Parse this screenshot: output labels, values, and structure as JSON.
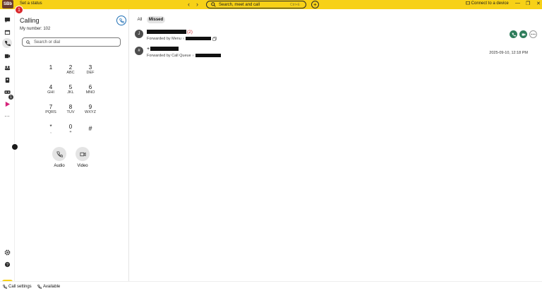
{
  "topbar": {
    "avatar_initials": "SBb",
    "notification_count": "1",
    "set_status": "Set a status",
    "back_arrow": "‹",
    "forward_arrow": "›",
    "search_placeholder": "Search, meet and call",
    "search_shortcut": "Ctrl+E",
    "add_symbol": "+",
    "connect_device": "Connect to a device",
    "minimize": "—",
    "restore": "❐",
    "close": "✕",
    "background_color": "#f7d117"
  },
  "rail": {
    "icons": [
      "chat-icon",
      "calendar-icon",
      "phone-icon",
      "meetings-icon",
      "teams-icon",
      "contacts-icon",
      "voicemail-icon",
      "apps-icon",
      "more-icon"
    ],
    "voicemail_badge": "1",
    "more_label": "…",
    "bottom_button_label": "➤"
  },
  "calling": {
    "title": "Calling",
    "my_number": "My number: 102",
    "search_placeholder": "Search or dial",
    "keys": [
      {
        "digit": "1",
        "letters": ""
      },
      {
        "digit": "2",
        "letters": "ABC"
      },
      {
        "digit": "3",
        "letters": "DEF"
      },
      {
        "digit": "4",
        "letters": "GHI"
      },
      {
        "digit": "5",
        "letters": "JKL"
      },
      {
        "digit": "6",
        "letters": "MNO"
      },
      {
        "digit": "7",
        "letters": "PQRS"
      },
      {
        "digit": "8",
        "letters": "TUV"
      },
      {
        "digit": "9",
        "letters": "WXYZ"
      },
      {
        "digit": "*",
        "letters": ","
      },
      {
        "digit": "0",
        "letters": "+"
      },
      {
        "digit": "#",
        "letters": ""
      }
    ],
    "audio_label": "Audio",
    "video_label": "Video"
  },
  "main": {
    "tabs": [
      {
        "label": "All",
        "active": false
      },
      {
        "label": "Missed",
        "active": true
      }
    ],
    "calls": [
      {
        "avatar": "J",
        "count": "(2)",
        "forwarded_by": "Forwarded by Menu",
        "arrow": "›",
        "time": ""
      },
      {
        "avatar": "#",
        "prefix": "+",
        "forwarded_by": "Forwarded by Call Queue",
        "arrow": "›",
        "time": "2025-09-10, 12:18 PM"
      }
    ]
  },
  "statusbar": {
    "call_settings": "Call settings",
    "availability": "Available"
  }
}
